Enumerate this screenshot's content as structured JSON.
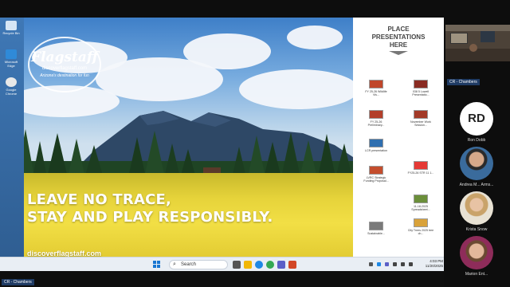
{
  "desktop": {
    "icons": [
      {
        "label": "Recycle Bin",
        "color": "#d6e6f5"
      },
      {
        "label": "Microsoft Edge",
        "color": "#2f8ad8"
      },
      {
        "label": "Google Chrome",
        "color": "#e8e8e8"
      }
    ]
  },
  "slide": {
    "logo_brand": "Flagstaff",
    "logo_url": "discoverflagstaff.com",
    "logo_tagline": "Arizona's destination for fun",
    "headline_line1": "LEAVE NO TRACE,",
    "headline_line2": "STAY AND PLAY RESPONSIBLY.",
    "site_url": "discoverflagstaff.com"
  },
  "presentations": {
    "header_line1": "PLACE",
    "header_line2": "PRESENTATIONS",
    "header_line3": "HERE",
    "files": [
      {
        "name": "FY 25-26 Wildlife Vis...",
        "color": "#c0462a"
      },
      {
        "name": "038 5 Lowell Presentatio...",
        "color": "#8a2b22"
      },
      {
        "name": "FY 25-26 Preliminary...",
        "color": "#b33f2a"
      },
      {
        "name": "November Work Session...",
        "color": "#a33a28"
      },
      {
        "name": "LCR presentation",
        "color": "#2f6fb0"
      },
      {
        "name": "LVRC Strategic Funding Proposal...",
        "color": "#c44d2d"
      },
      {
        "name": "FY25-26 STR 11 1...",
        "color": "#e53935"
      },
      {
        "name": "11-18-2025 Spreadsheet...",
        "color": "#6b8f3a"
      },
      {
        "name": "Sustainable...",
        "color": "#7a7a7a"
      },
      {
        "name": "City Trees 2025 tree ch...",
        "color": "#d9a23a"
      }
    ]
  },
  "taskbar": {
    "search_placeholder": "Search",
    "time": "4:03 PM",
    "date": "11/20/2025",
    "apps": [
      {
        "name": "task-view",
        "color": "#555555"
      },
      {
        "name": "file-explorer",
        "color": "#f2b705"
      },
      {
        "name": "edge",
        "color": "#1e88e5"
      },
      {
        "name": "chrome",
        "color": "#34a853"
      },
      {
        "name": "teams",
        "color": "#5b5fc7"
      },
      {
        "name": "powerpoint",
        "color": "#d24726"
      }
    ]
  },
  "meeting": {
    "share_label": "CR - Chambers",
    "camera_label": "CR - Chambers",
    "participants": [
      {
        "initials": "RD",
        "name": "Ron Dobb",
        "type": "initials"
      },
      {
        "name": "Andrea M... Arms...",
        "type": "photo",
        "color": "#3a6b9c"
      },
      {
        "name": "Krista Snow",
        "type": "photo",
        "color": "#c9a36a"
      },
      {
        "name": "Marion Ent...",
        "type": "photo",
        "color": "#8e2c5a"
      }
    ]
  }
}
